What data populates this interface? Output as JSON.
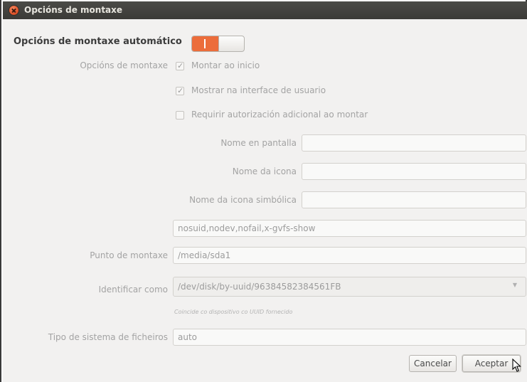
{
  "window": {
    "title": "Opcións de montaxe"
  },
  "auto_mount": {
    "label": "Opcións de montaxe automático",
    "enabled": false
  },
  "mount_options": {
    "label": "Opcións de montaxe",
    "checkboxes": [
      {
        "label": "Montar ao inicio",
        "checked": true
      },
      {
        "label": "Mostrar na interface de usuario",
        "checked": true
      },
      {
        "label": "Requirir autorización adicional ao montar",
        "checked": false
      }
    ]
  },
  "fields": {
    "display_name": {
      "label": "Nome en pantalla",
      "value": ""
    },
    "icon_name": {
      "label": "Nome da icona",
      "value": ""
    },
    "symbolic_icon_name": {
      "label": "Nome da icona simbólica",
      "value": ""
    },
    "options_value": "nosuid,nodev,nofail,x-gvfs-show",
    "mount_point": {
      "label": "Punto de montaxe",
      "value": "/media/sda1"
    },
    "identify_as": {
      "label": "Identificar como",
      "value": "/dev/disk/by-uuid/96384582384561FB",
      "hint": "Coincide co dispositivo co UUID fornecido"
    },
    "fs_type": {
      "label": "Tipo de sistema de ficheiros",
      "value": "auto"
    }
  },
  "buttons": {
    "cancel": "Cancelar",
    "accept": "Aceptar"
  },
  "icons": {
    "close": "close-icon",
    "combo": "chevron-down-icon",
    "cursor": "cursor-icon"
  },
  "colors": {
    "accent": "#ec6d3b",
    "titlebar": "#3b3a37",
    "close": "#e1542b"
  }
}
